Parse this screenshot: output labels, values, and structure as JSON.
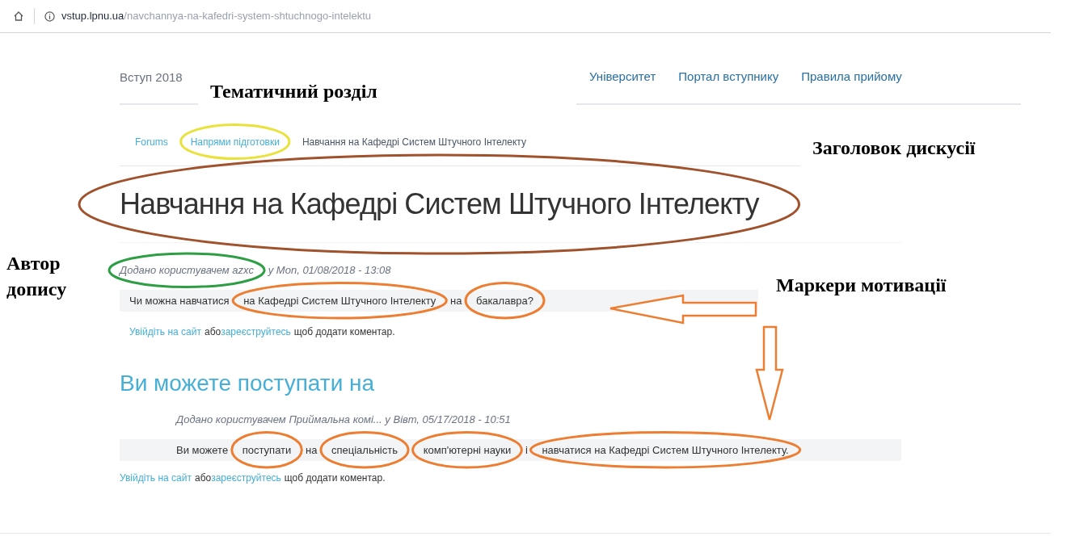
{
  "browser": {
    "url_domain": "vstup.lpnu.ua",
    "url_path": "/navchannya-na-kafedri-system-shtuchnogo-intelektu"
  },
  "nav": {
    "brand": "Вступ 2018",
    "links": [
      "Університет",
      "Портал вступнику",
      "Правила прийому"
    ]
  },
  "breadcrumb": [
    "Forums",
    "Напрями підготовки",
    "Навчання на Кафедрі Систем Штучного Інтелекту"
  ],
  "title": "Навчання на Кафедрі Систем Штучного Інтелекту",
  "post": {
    "meta": "Додано користувачем azxc у Mon, 01/08/2018 - 13:08",
    "body": "Чи можна навчатися на Кафедрі Систем Штучного Інтелекту на бакалавра?",
    "login_link": "Увійдіть на сайт",
    "or": "або",
    "register_link": "зареєструйтесь",
    "rest": "щоб додати коментар."
  },
  "comment": {
    "title": "Ви можете поступати на",
    "meta": "Додано користувачем Приймальна комі... у Вівт, 05/17/2018 - 10:51",
    "body": "Ви можете поступати на спеціальність комп'ютерні науки і навчатися на Кафедрі Систем Штучного Інтелекту.",
    "login_link": "Увійдіть на сайт",
    "or": "або",
    "register_link": "зареєструйтесь",
    "rest": "щоб додати коментар."
  },
  "annotations": [
    "Тематичний розділ",
    "Заголовок дискусії",
    "Автор допису",
    "Маркери мотивації"
  ],
  "highlights": [
    {
      "color": "#e8e23a"
    },
    {
      "color": "#a0522d"
    },
    {
      "color": "#2e9e44"
    },
    {
      "color": "#ed7d31"
    },
    {
      "color": "#ed7d31"
    },
    {
      "color": "#ed7d31"
    },
    {
      "color": "#ed7d31"
    },
    {
      "color": "#ed7d31"
    },
    {
      "color": "#ed7d31"
    }
  ]
}
